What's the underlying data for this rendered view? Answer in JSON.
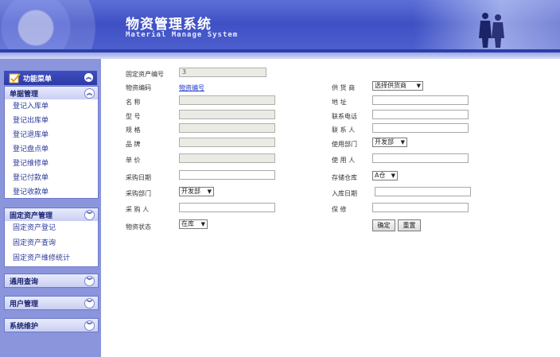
{
  "header": {
    "title_cn": "物资管理系统",
    "title_en": "Material Manage System"
  },
  "sidebar": {
    "menu_title": "功能菜单",
    "sections": [
      {
        "title": "单据管理",
        "items": [
          "登记入库单",
          "登记出库单",
          "登记退库单",
          "登记盘点单",
          "登记维修单",
          "登记付款单",
          "登记收款单"
        ]
      },
      {
        "title": "固定资产管理",
        "items": [
          "固定资产登记",
          "固定资产查询",
          "固定资产维修统计"
        ]
      },
      {
        "title": "通用查询",
        "items": []
      },
      {
        "title": "用户管理",
        "items": []
      },
      {
        "title": "系统维护",
        "items": []
      }
    ]
  },
  "form": {
    "asset_no": {
      "label": "固定资产编号",
      "value": "3"
    },
    "material_code": {
      "label": "物资编码",
      "link": "物资编号"
    },
    "name": {
      "label": "名  称",
      "value": ""
    },
    "model": {
      "label": "型  号",
      "value": ""
    },
    "spec": {
      "label": "规  格",
      "value": ""
    },
    "brand": {
      "label": "品  牌",
      "value": ""
    },
    "price": {
      "label": "单  价",
      "value": ""
    },
    "purchase_date": {
      "label": "采购日期",
      "value": ""
    },
    "purchase_dept": {
      "label": "采购部门",
      "value": "开发部"
    },
    "purchaser": {
      "label": "采 购 人",
      "value": ""
    },
    "status": {
      "label": "物资状态",
      "value": "在库"
    },
    "supplier": {
      "label": "供 货 商",
      "value": "选择供货商"
    },
    "address": {
      "label": "地  址",
      "value": ""
    },
    "phone": {
      "label": "联系电话",
      "value": ""
    },
    "contact": {
      "label": "联 系 人",
      "value": ""
    },
    "use_dept": {
      "label": "使用部门",
      "value": "开发部"
    },
    "user": {
      "label": "使 用 人",
      "value": ""
    },
    "warehouse": {
      "label": "存储仓库",
      "value": "A仓"
    },
    "in_date": {
      "label": "入库日期",
      "value": ""
    },
    "warranty": {
      "label": "保  修",
      "value": ""
    },
    "ok_button": "确定",
    "reset_button": "重置"
  },
  "colors": {
    "accent": "#3e50c4",
    "sidebar": "#8a95dc",
    "link": "#1c34c8"
  }
}
